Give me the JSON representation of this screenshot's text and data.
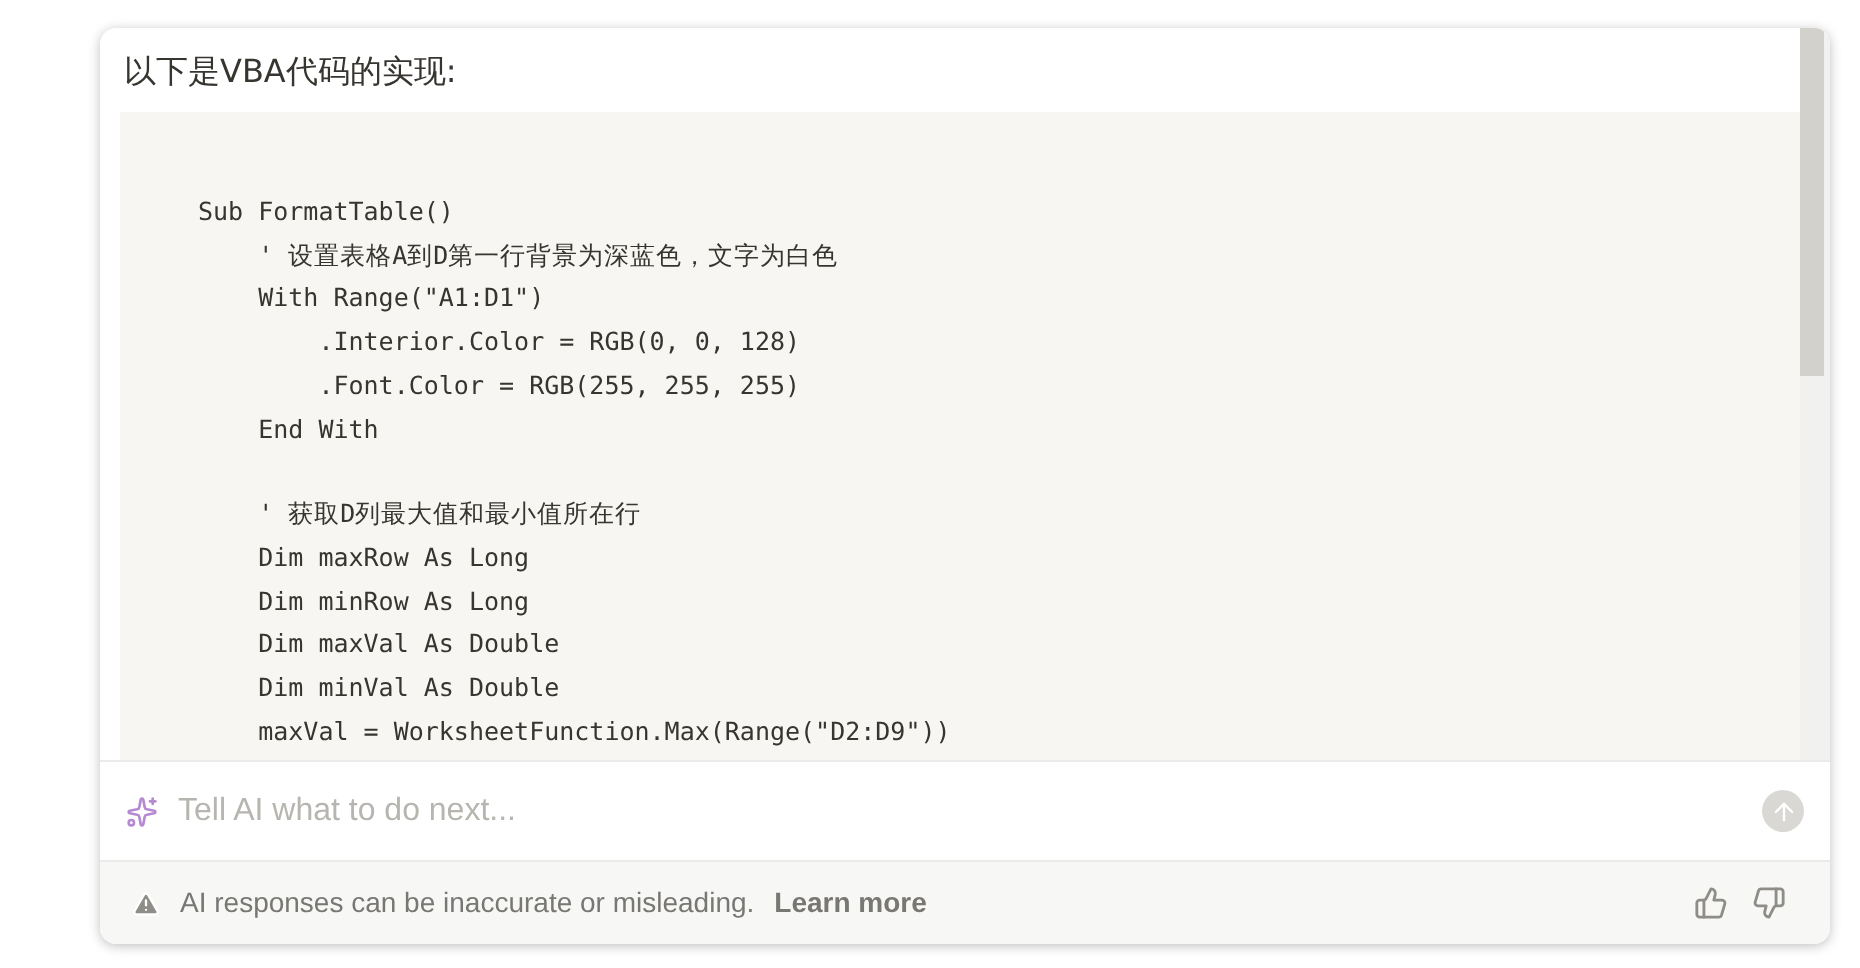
{
  "message": {
    "heading": "以下是VBA代码的实现:",
    "code_groups": [
      [
        "Sub FormatTable()",
        "    ' 设置表格A到D第一行背景为深蓝色，文字为白色",
        "    With Range(\"A1:D1\")",
        "        .Interior.Color = RGB(0, 0, 128)",
        "        .Font.Color = RGB(255, 255, 255)",
        "    End With"
      ],
      [
        "    ' 获取D列最大值和最小值所在行",
        "    Dim maxRow As Long",
        "    Dim minRow As Long",
        "    Dim maxVal As Double",
        "    Dim minVal As Double",
        "    maxVal = WorksheetFunction.Max(Range(\"D2:D9\"))"
      ]
    ]
  },
  "prompt": {
    "placeholder": "Tell AI what to do next..."
  },
  "footer": {
    "disclaimer": "AI responses can be inaccurate or misleading.",
    "link": "Learn more"
  }
}
